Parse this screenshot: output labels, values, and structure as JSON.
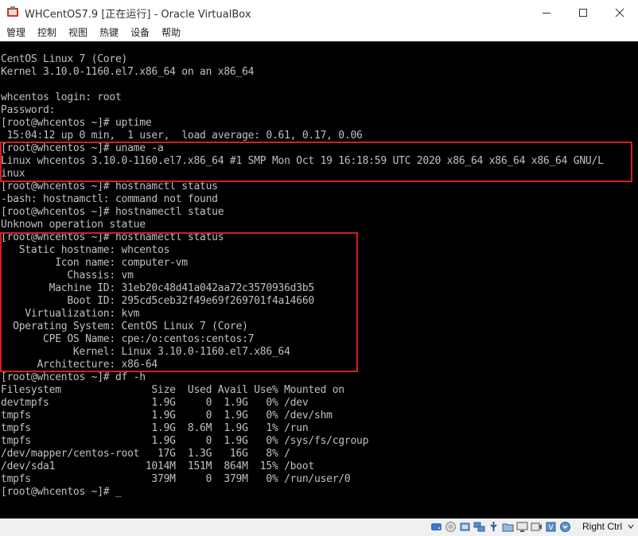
{
  "window": {
    "title": "WHCentOS7.9 [正在运行] - Oracle VirtualBox"
  },
  "menu": [
    "管理",
    "控制",
    "视图",
    "热键",
    "设备",
    "帮助"
  ],
  "terminal": {
    "lines": [
      "CentOS Linux 7 (Core)",
      "Kernel 3.10.0-1160.el7.x86_64 on an x86_64",
      "",
      "whcentos login: root",
      "Password:",
      "[root@whcentos ~]# uptime",
      " 15:04:12 up 0 min,  1 user,  load average: 0.61, 0.17, 0.06",
      "[root@whcentos ~]# uname -a",
      "Linux whcentos 3.10.0-1160.el7.x86_64 #1 SMP Mon Oct 19 16:18:59 UTC 2020 x86_64 x86_64 x86_64 GNU/L",
      "inux",
      "[root@whcentos ~]# hostnamctl status",
      "-bash: hostnamctl: command not found",
      "[root@whcentos ~]# hostnamectl statue",
      "Unknown operation statue",
      "[root@whcentos ~]# hostnamectl status",
      "   Static hostname: whcentos",
      "         Icon name: computer-vm",
      "           Chassis: vm",
      "        Machine ID: 31eb20c48d41a042aa72c3570936d3b5",
      "           Boot ID: 295cd5ceb32f49e69f269701f4a14660",
      "    Virtualization: kvm",
      "  Operating System: CentOS Linux 7 (Core)",
      "       CPE OS Name: cpe:/o:centos:centos:7",
      "            Kernel: Linux 3.10.0-1160.el7.x86_64",
      "      Architecture: x86-64",
      "[root@whcentos ~]# df -h",
      "Filesystem               Size  Used Avail Use% Mounted on",
      "devtmpfs                 1.9G     0  1.9G   0% /dev",
      "tmpfs                    1.9G     0  1.9G   0% /dev/shm",
      "tmpfs                    1.9G  8.6M  1.9G   1% /run",
      "tmpfs                    1.9G     0  1.9G   0% /sys/fs/cgroup",
      "/dev/mapper/centos-root   17G  1.3G   16G   8% /",
      "/dev/sda1               1014M  151M  864M  15% /boot",
      "tmpfs                    379M     0  379M   0% /run/user/0",
      "[root@whcentos ~]# _"
    ]
  },
  "statusbar": {
    "host_key": "Right Ctrl"
  },
  "colors": {
    "highlight_border": "#d21f1f",
    "console_bg": "#000000",
    "console_text": "#c0c0c0"
  }
}
